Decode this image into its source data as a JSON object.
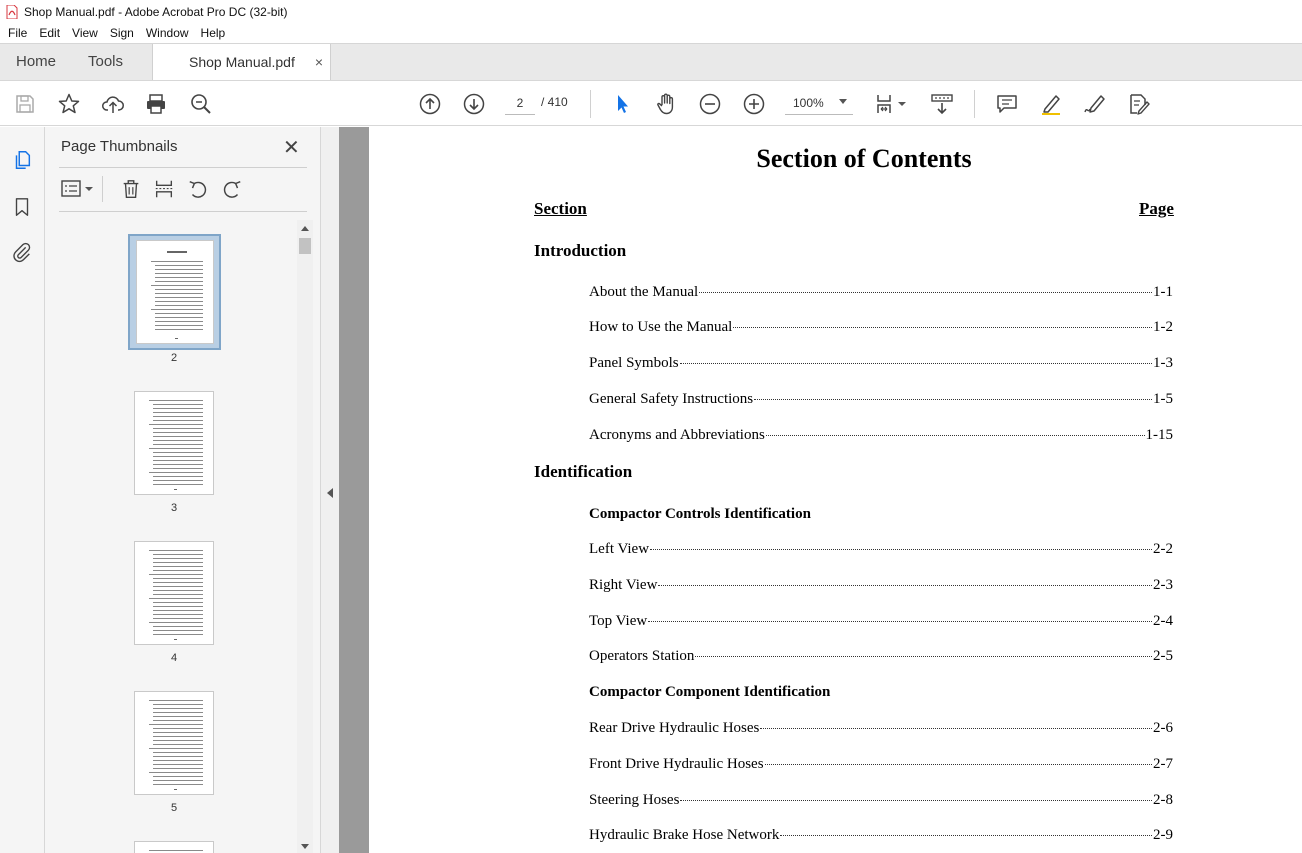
{
  "window": {
    "title": "Shop Manual.pdf - Adobe Acrobat Pro DC (32-bit)"
  },
  "menu": [
    "File",
    "Edit",
    "View",
    "Sign",
    "Window",
    "Help"
  ],
  "tabs": {
    "home": "Home",
    "tools": "Tools",
    "document": "Shop Manual.pdf",
    "close": "×"
  },
  "toolbar": {
    "current_page": "2",
    "page_total": "/  410",
    "zoom": "100%"
  },
  "panel": {
    "title": "Page Thumbnails",
    "close": "✕",
    "thumbnails": [
      {
        "label": "2",
        "selected": true
      },
      {
        "label": "3",
        "selected": false
      },
      {
        "label": "4",
        "selected": false
      },
      {
        "label": "5",
        "selected": false
      }
    ]
  },
  "document": {
    "title": "Section of Contents",
    "section_col": "Section",
    "page_col": "Page",
    "sections": {
      "intro": "Introduction",
      "ident": "Identification"
    },
    "subheads": {
      "controls": "Compactor Controls Identification",
      "components": "Compactor Component Identification"
    },
    "entries": [
      {
        "title": "About the Manual ",
        "page": "1-1"
      },
      {
        "title": "How to Use the Manual ",
        "page": "1-2"
      },
      {
        "title": "Panel Symbols",
        "page": "1-3"
      },
      {
        "title": "General Safety Instructions",
        "page": "1-5"
      },
      {
        "title": "Acronyms and Abbreviations ",
        "page": "1-15"
      },
      {
        "title": "Left View ",
        "page": "2-2"
      },
      {
        "title": "Right View",
        "page": "2-3"
      },
      {
        "title": "Top View ",
        "page": "2-4"
      },
      {
        "title": "Operators Station ",
        "page": "2-5"
      },
      {
        "title": "Rear Drive Hydraulic Hoses ",
        "page": "2-6"
      },
      {
        "title": "Front Drive Hydraulic Hoses",
        "page": "2-7"
      },
      {
        "title": "Steering Hoses ",
        "page": "2-8"
      },
      {
        "title": "Hydraulic Brake Hose Network",
        "page": "2-9"
      }
    ]
  },
  "colors": {
    "accent": "#1473e6",
    "toolbar_bg": "#ffffff",
    "tabbar_bg": "#e9e9e9",
    "pdf_icon": "#d7373f"
  }
}
